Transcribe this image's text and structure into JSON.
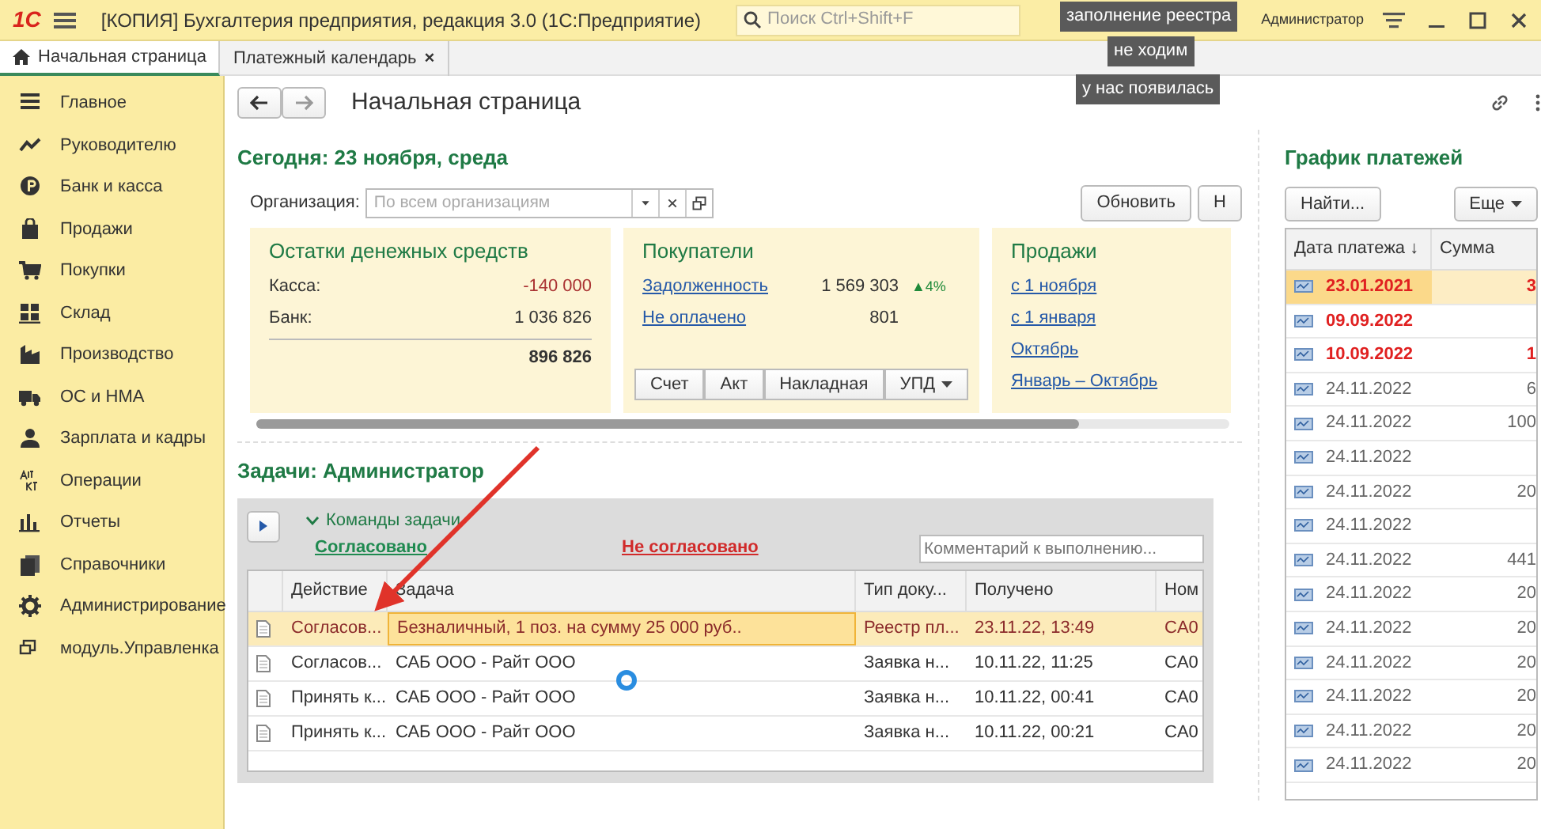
{
  "window": {
    "logo": "1С",
    "title": "[КОПИЯ] Бухгалтерия предприятия, редакция 3.0  (1С:Предприятие)",
    "search_placeholder": "Поиск Ctrl+Shift+F",
    "user": "Администратор"
  },
  "tabs": [
    {
      "label": "Начальная страница",
      "selected": true
    },
    {
      "label": "Платежный календарь",
      "selected": false,
      "close": "×"
    }
  ],
  "sidebar": {
    "items": [
      {
        "label": "Главное"
      },
      {
        "label": "Руководителю"
      },
      {
        "label": "Банк и касса"
      },
      {
        "label": "Продажи"
      },
      {
        "label": "Покупки"
      },
      {
        "label": "Склад"
      },
      {
        "label": "Производство"
      },
      {
        "label": "ОС и НМА"
      },
      {
        "label": "Зарплата и кадры"
      },
      {
        "label": "Операции"
      },
      {
        "label": "Отчеты"
      },
      {
        "label": "Справочники"
      },
      {
        "label": "Администрирование"
      },
      {
        "label": "модуль.Управленка"
      }
    ]
  },
  "page": {
    "title": "Начальная страница"
  },
  "today": {
    "title": "Сегодня: 23 ноября, среда",
    "org_label": "Организация:",
    "org_placeholder": "По всем организациям",
    "buttons": [
      "Обновить",
      "Н"
    ]
  },
  "cash": {
    "title": "Остатки денежных средств",
    "rows": [
      {
        "label": "Касса:",
        "value": "-140 000",
        "negative": true
      },
      {
        "label": "Банк:",
        "value": "1 036 826",
        "negative": false
      }
    ],
    "total": "896 826"
  },
  "buyers": {
    "title": "Покупатели",
    "rows": [
      {
        "label": "Задолженность",
        "value": "1 569 303",
        "trend": "▲4%"
      },
      {
        "label": "Не оплачено",
        "value": "801"
      }
    ],
    "buttons": [
      {
        "label": "Счет",
        "dropdown": false
      },
      {
        "label": "Акт",
        "dropdown": false
      },
      {
        "label": "Накладная",
        "dropdown": false
      },
      {
        "label": "УПД",
        "dropdown": true
      }
    ]
  },
  "sales": {
    "title": "Продажи",
    "links": [
      "с 1 ноября",
      "с 1 января",
      "Октябрь",
      "Январь – Октябрь"
    ]
  },
  "tasks": {
    "title": "Задачи: Администратор",
    "commands": "Команды задачи",
    "approve": "Согласовано",
    "reject": "Не согласовано",
    "comment_placeholder": "Комментарий к выполнению...",
    "columns": [
      "Действие",
      "Задача",
      "Тип доку...",
      "Получено",
      "Ном"
    ],
    "rows": [
      {
        "selected": true,
        "cells": [
          "Согласов...",
          "Безналичный, 1 поз. на сумму 25 000 руб..",
          "Реестр пл...",
          "23.11.22, 13:49",
          "CA0"
        ]
      },
      {
        "selected": false,
        "cells": [
          "Согласов...",
          "САБ ООО - Райт ООО",
          "Заявка н...",
          "10.11.22, 11:25",
          "CA0"
        ]
      },
      {
        "selected": false,
        "cells": [
          "Принять к...",
          "САБ ООО - Райт ООО",
          "Заявка н...",
          "10.11.22, 00:41",
          "CA0"
        ]
      },
      {
        "selected": false,
        "cells": [
          "Принять к...",
          "САБ ООО - Райт ООО",
          "Заявка н...",
          "10.11.22, 00:21",
          "CA0"
        ]
      }
    ]
  },
  "payments": {
    "title": "График платежей",
    "find": "Найти...",
    "more": "Еще",
    "columns": [
      "Дата платежа ↓",
      "Сумма"
    ],
    "rows": [
      {
        "date": "23.01.2021",
        "sum": "3",
        "overdue": true,
        "selected": true
      },
      {
        "date": "09.09.2022",
        "overdue": true,
        "selected": false
      },
      {
        "date": "10.09.2022",
        "sum": "1",
        "overdue": true,
        "selected": false
      },
      {
        "date": "24.11.2022",
        "sum": "6",
        "overdue": false,
        "selected": false
      },
      {
        "date": "24.11.2022",
        "sum": "100",
        "overdue": false,
        "selected": false
      },
      {
        "date": "24.11.2022",
        "overdue": false,
        "selected": false
      },
      {
        "date": "24.11.2022",
        "sum": "20",
        "overdue": false,
        "selected": false
      },
      {
        "date": "24.11.2022",
        "overdue": false,
        "selected": false
      },
      {
        "date": "24.11.2022",
        "sum": "441",
        "overdue": false,
        "selected": false
      },
      {
        "date": "24.11.2022",
        "sum": "20",
        "overdue": false,
        "selected": false
      },
      {
        "date": "24.11.2022",
        "sum": "20",
        "overdue": false,
        "selected": false
      },
      {
        "date": "24.11.2022",
        "sum": "20",
        "overdue": false,
        "selected": false
      },
      {
        "date": "24.11.2022",
        "sum": "20",
        "overdue": false,
        "selected": false
      },
      {
        "date": "24.11.2022",
        "sum": "20",
        "overdue": false,
        "selected": false
      },
      {
        "date": "24.11.2022",
        "sum": "20",
        "overdue": false,
        "selected": false
      }
    ]
  },
  "captions": [
    "заполнение реестра",
    "не ходим",
    "у нас появилась"
  ]
}
